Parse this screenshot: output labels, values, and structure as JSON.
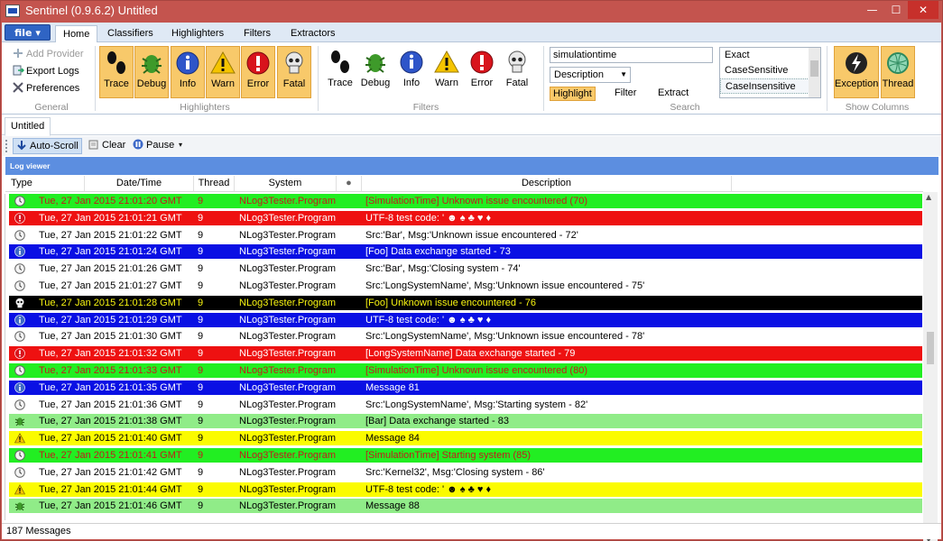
{
  "window": {
    "title": "Sentinel (0.9.6.2) Untitled",
    "minimize_glyph": "—",
    "maximize_glyph": "☐",
    "close_glyph": "✕"
  },
  "ribbon": {
    "file_label": "file ▾",
    "tabs": [
      {
        "label": "Home",
        "active": true
      },
      {
        "label": "Classifiers"
      },
      {
        "label": "Highlighters"
      },
      {
        "label": "Filters"
      },
      {
        "label": "Extractors"
      }
    ],
    "general": {
      "label": "General",
      "add_provider": "Add Provider",
      "export_logs": "Export Logs",
      "preferences": "Preferences"
    },
    "highlighters": {
      "label": "Highlighters",
      "buttons": [
        "Trace",
        "Debug",
        "Info",
        "Warn",
        "Error",
        "Fatal"
      ]
    },
    "filters": {
      "label": "Filters",
      "buttons": [
        "Trace",
        "Debug",
        "Info",
        "Warn",
        "Error",
        "Fatal"
      ]
    },
    "search": {
      "label": "Search",
      "query": "simulationtime",
      "field": "Description",
      "modes": [
        "Highlight",
        "Filter",
        "Extract"
      ],
      "active_mode": "Highlight",
      "match_options": [
        "Exact",
        "CaseSensitive",
        "CaseInsensitive"
      ],
      "selected_match": "CaseInsensitive"
    },
    "show_columns": {
      "label": "Show Columns",
      "buttons": [
        "Exception",
        "Thread"
      ]
    }
  },
  "doc_tab": "Untitled",
  "toolbar": {
    "auto_scroll": "Auto-Scroll",
    "clear": "Clear",
    "pause": "Pause",
    "more_glyph": "▾"
  },
  "log_viewer": {
    "title": "Log viewer",
    "columns": [
      "Type",
      "Date/Time",
      "Thread",
      "System",
      "Description"
    ],
    "exception_col_glyph": "●"
  },
  "row_styles": {
    "sim": {
      "bg": "#22ee22",
      "fg": "#c21b1b"
    },
    "error": {
      "bg": "#ee1111",
      "fg": "#ffffff"
    },
    "trace": {
      "bg": "#ffffff",
      "fg": "#000000"
    },
    "info": {
      "bg": "#0a10e4",
      "fg": "#ffffff"
    },
    "fatal": {
      "bg": "#000000",
      "fg": "#f7f410"
    },
    "debug": {
      "bg": "#90ec88",
      "fg": "#000000"
    },
    "warn": {
      "bg": "#fbfb00",
      "fg": "#000000"
    }
  },
  "rows": [
    {
      "style": "sim",
      "icon": "clock-icon",
      "datetime": "Tue, 27 Jan 2015 21:01:20 GMT",
      "thread": "9",
      "system": "NLog3Tester.Program",
      "description": "[SimulationTime] Unknown issue encountered (70)"
    },
    {
      "style": "error",
      "icon": "error-icon",
      "datetime": "Tue, 27 Jan 2015 21:01:21 GMT",
      "thread": "9",
      "system": "NLog3Tester.Program",
      "description": "UTF-8 test code: ' ☻ ♠ ♣ ♥ ♦"
    },
    {
      "style": "trace",
      "icon": "clock-icon",
      "datetime": "Tue, 27 Jan 2015 21:01:22 GMT",
      "thread": "9",
      "system": "NLog3Tester.Program",
      "description": "Src:'Bar', Msg:'Unknown issue encountered - 72'"
    },
    {
      "style": "info",
      "icon": "info-icon",
      "datetime": "Tue, 27 Jan 2015 21:01:24 GMT",
      "thread": "9",
      "system": "NLog3Tester.Program",
      "description": "[Foo] Data exchange started - 73"
    },
    {
      "style": "trace",
      "icon": "clock-icon",
      "datetime": "Tue, 27 Jan 2015 21:01:26 GMT",
      "thread": "9",
      "system": "NLog3Tester.Program",
      "description": "Src:'Bar', Msg:'Closing system - 74'"
    },
    {
      "style": "trace",
      "icon": "clock-icon",
      "datetime": "Tue, 27 Jan 2015 21:01:27 GMT",
      "thread": "9",
      "system": "NLog3Tester.Program",
      "description": "Src:'LongSystemName', Msg:'Unknown issue encountered - 75'"
    },
    {
      "style": "fatal",
      "icon": "skull-icon",
      "datetime": "Tue, 27 Jan 2015 21:01:28 GMT",
      "thread": "9",
      "system": "NLog3Tester.Program",
      "description": "[Foo] Unknown issue encountered - 76"
    },
    {
      "style": "info",
      "icon": "info-icon",
      "datetime": "Tue, 27 Jan 2015 21:01:29 GMT",
      "thread": "9",
      "system": "NLog3Tester.Program",
      "description": "UTF-8 test code: ' ☻ ♠ ♣ ♥ ♦"
    },
    {
      "style": "trace",
      "icon": "clock-icon",
      "datetime": "Tue, 27 Jan 2015 21:01:30 GMT",
      "thread": "9",
      "system": "NLog3Tester.Program",
      "description": "Src:'LongSystemName', Msg:'Unknown issue encountered - 78'"
    },
    {
      "style": "error",
      "icon": "error-icon",
      "datetime": "Tue, 27 Jan 2015 21:01:32 GMT",
      "thread": "9",
      "system": "NLog3Tester.Program",
      "description": "[LongSystemName] Data exchange started - 79"
    },
    {
      "style": "sim",
      "icon": "clock-icon",
      "datetime": "Tue, 27 Jan 2015 21:01:33 GMT",
      "thread": "9",
      "system": "NLog3Tester.Program",
      "description": "[SimulationTime] Unknown issue encountered (80)"
    },
    {
      "style": "info",
      "icon": "info-icon",
      "datetime": "Tue, 27 Jan 2015 21:01:35 GMT",
      "thread": "9",
      "system": "NLog3Tester.Program",
      "description": "Message 81"
    },
    {
      "style": "trace",
      "icon": "clock-icon",
      "datetime": "Tue, 27 Jan 2015 21:01:36 GMT",
      "thread": "9",
      "system": "NLog3Tester.Program",
      "description": "Src:'LongSystemName', Msg:'Starting system - 82'"
    },
    {
      "style": "debug",
      "icon": "bug-icon",
      "datetime": "Tue, 27 Jan 2015 21:01:38 GMT",
      "thread": "9",
      "system": "NLog3Tester.Program",
      "description": "[Bar] Data exchange started - 83"
    },
    {
      "style": "warn",
      "icon": "warning-icon",
      "datetime": "Tue, 27 Jan 2015 21:01:40 GMT",
      "thread": "9",
      "system": "NLog3Tester.Program",
      "description": "Message 84"
    },
    {
      "style": "sim",
      "icon": "clock-icon",
      "datetime": "Tue, 27 Jan 2015 21:01:41 GMT",
      "thread": "9",
      "system": "NLog3Tester.Program",
      "description": "[SimulationTime] Starting system (85)"
    },
    {
      "style": "trace",
      "icon": "clock-icon",
      "datetime": "Tue, 27 Jan 2015 21:01:42 GMT",
      "thread": "9",
      "system": "NLog3Tester.Program",
      "description": "Src:'Kernel32', Msg:'Closing system - 86'"
    },
    {
      "style": "warn",
      "icon": "warning-icon",
      "datetime": "Tue, 27 Jan 2015 21:01:44 GMT",
      "thread": "9",
      "system": "NLog3Tester.Program",
      "description": "UTF-8 test code: ' ☻ ♠ ♣ ♥ ♦"
    },
    {
      "style": "debug",
      "icon": "bug-icon",
      "datetime": "Tue, 27 Jan 2015 21:01:46 GMT",
      "thread": "9",
      "system": "NLog3Tester.Program",
      "description": "Message 88"
    }
  ],
  "status": {
    "message_count": "187 Messages"
  }
}
